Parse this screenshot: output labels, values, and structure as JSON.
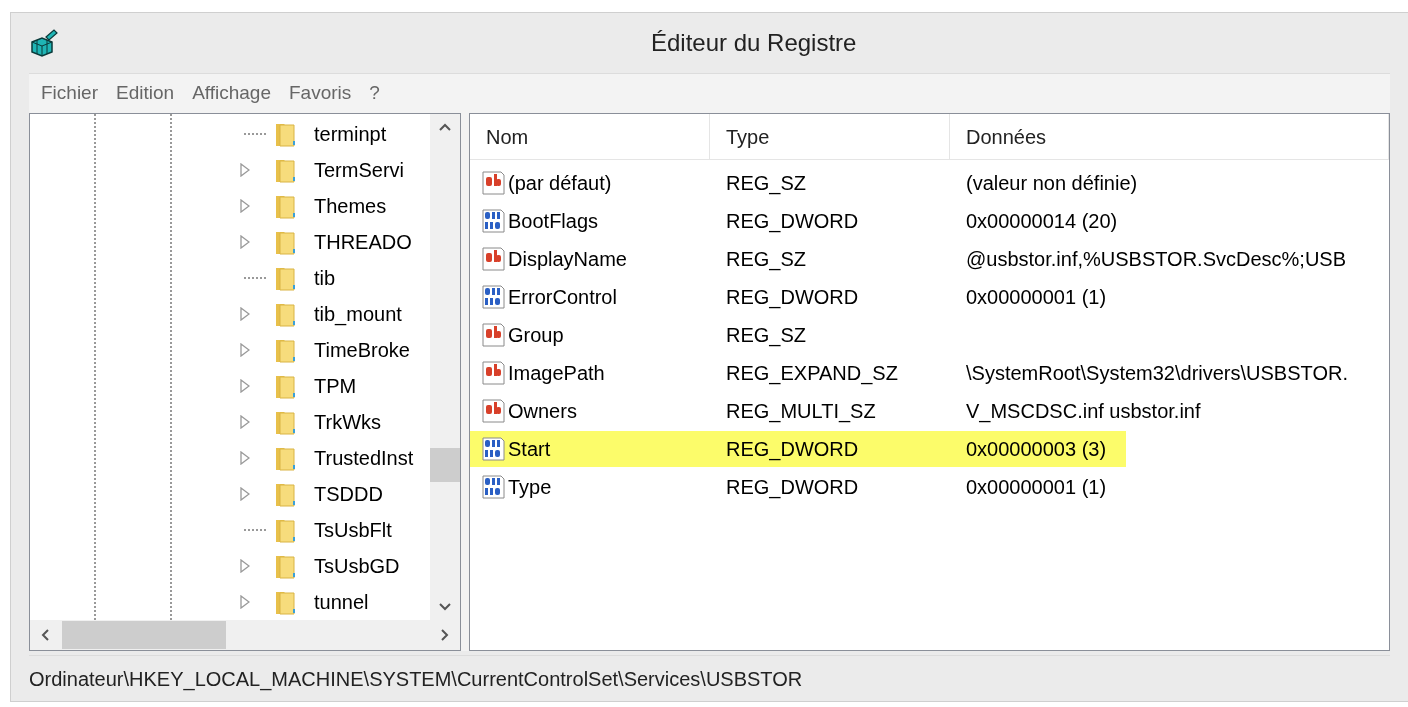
{
  "window": {
    "title": "Éditeur du Registre"
  },
  "menu": [
    "Fichier",
    "Edition",
    "Affichage",
    "Favoris",
    "?"
  ],
  "tree": {
    "items": [
      {
        "label": "terminpt",
        "expandable": false
      },
      {
        "label": "TermServi",
        "expandable": true
      },
      {
        "label": "Themes",
        "expandable": true
      },
      {
        "label": "THREADO",
        "expandable": true
      },
      {
        "label": "tib",
        "expandable": false
      },
      {
        "label": "tib_mount",
        "expandable": true
      },
      {
        "label": "TimeBroke",
        "expandable": true
      },
      {
        "label": "TPM",
        "expandable": true
      },
      {
        "label": "TrkWks",
        "expandable": true
      },
      {
        "label": "TrustedInst",
        "expandable": true
      },
      {
        "label": "TSDDD",
        "expandable": true
      },
      {
        "label": "TsUsbFlt",
        "expandable": false
      },
      {
        "label": "TsUsbGD",
        "expandable": true
      },
      {
        "label": "tunnel",
        "expandable": true
      }
    ]
  },
  "table": {
    "columns": [
      "Nom",
      "Type",
      "Données"
    ],
    "rows": [
      {
        "kind": "string",
        "name": "(par défaut)",
        "type": "REG_SZ",
        "data": "(valeur non définie)",
        "highlighted": false
      },
      {
        "kind": "binary",
        "name": "BootFlags",
        "type": "REG_DWORD",
        "data": "0x00000014 (20)",
        "highlighted": false
      },
      {
        "kind": "string",
        "name": "DisplayName",
        "type": "REG_SZ",
        "data": "@usbstor.inf,%USBSTOR.SvcDesc%;USB",
        "highlighted": false
      },
      {
        "kind": "binary",
        "name": "ErrorControl",
        "type": "REG_DWORD",
        "data": "0x00000001 (1)",
        "highlighted": false
      },
      {
        "kind": "string",
        "name": "Group",
        "type": "REG_SZ",
        "highlighted": false
      },
      {
        "kind": "string",
        "name": "ImagePath",
        "type": "REG_EXPAND_SZ",
        "data": "\\SystemRoot\\System32\\drivers\\USBSTOR.",
        "highlighted": false
      },
      {
        "kind": "string",
        "name": "Owners",
        "type": "REG_MULTI_SZ",
        "data": "V_MSCDSC.inf usbstor.inf",
        "highlighted": false
      },
      {
        "kind": "binary",
        "name": "Start",
        "type": "REG_DWORD",
        "data": "0x00000003 (3)",
        "highlighted": true
      },
      {
        "kind": "binary",
        "name": "Type",
        "type": "REG_DWORD",
        "data": "0x00000001 (1)",
        "highlighted": false
      }
    ]
  },
  "status_bar": "Ordinateur\\HKEY_LOCAL_MACHINE\\SYSTEM\\CurrentControlSet\\Services\\USBSTOR"
}
